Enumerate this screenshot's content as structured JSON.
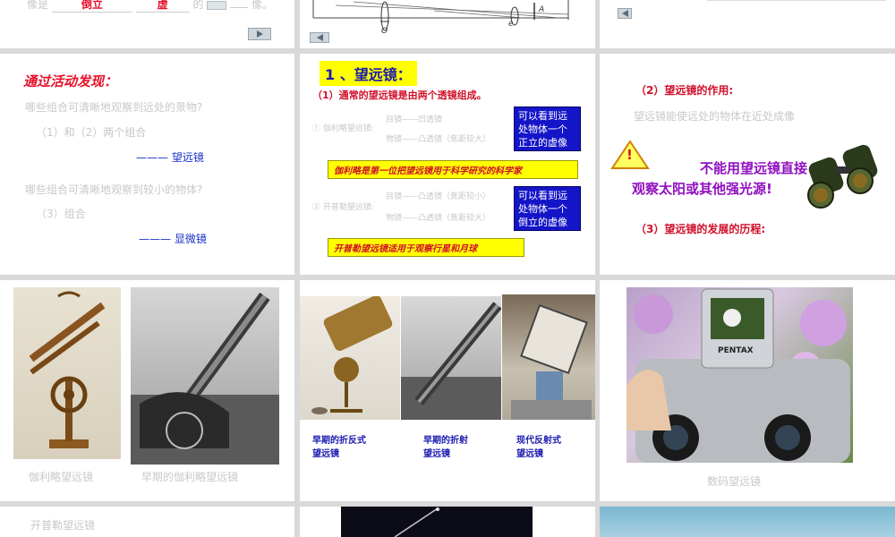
{
  "slide1": {
    "text_prefix": "像是",
    "blank1": "倒立",
    "blank2": "虚",
    "text_mid": "的",
    "text_suffix": "像。"
  },
  "slide2": {
    "label_o": "O",
    "label_e": "e",
    "label_a": "A"
  },
  "slide4": {
    "heading": "通过活动发现：",
    "q1": "哪些组合可清晰地观察到远处的景物?",
    "a1": "（1）和（2）两个组合",
    "r1": "——— 望远镜",
    "q2": "哪些组合可清晰地观察到较小的物体?",
    "a2": "（3）组合",
    "r2": "——— 显微镜"
  },
  "slide5": {
    "title": "1 、望远镜：",
    "subtitle": "（1）通常的望远镜是由两个透镜组成。",
    "g_label": "① 伽利略望远镜:",
    "g_eye": "目镜——凹透镜",
    "g_obj": "物镜——凸透镜（焦距较大）",
    "g_box": [
      "可以看到远",
      "处物体一个",
      "正立的虚像"
    ],
    "g_bar": "伽利略是第一位把望远镜用于科学研究的科学家",
    "k_label": "② 开普勒望远镜:",
    "k_eye": "目镜——凸透镜（焦距较小）",
    "k_obj": "物镜——凸透镜（焦距较大）",
    "k_box": [
      "可以看到远",
      "处物体一个",
      "倒立的虚像"
    ],
    "k_bar": "开普勒望远镜适用于观察行星和月球"
  },
  "slide6": {
    "sub2": "（2）望远镜的作用:",
    "effect": "望远镜能使远处的物体在近处成像",
    "warning_mark": "!",
    "warning_line1": "不能用望远镜直接",
    "warning_line2": "观察太阳或其他强光源!",
    "sub3": "（3）望远镜的发展的历程:"
  },
  "slide7": {
    "cap1": "伽利略望远镜",
    "cap2": "早期的伽利略望远镜"
  },
  "slide8": {
    "cap1": [
      "早期的折反式",
      "望远镜"
    ],
    "cap2": [
      "早期的折射",
      "望远镜"
    ],
    "cap3": [
      "现代反射式",
      "望远镜"
    ]
  },
  "slide9": {
    "brand": "PENTAX",
    "caption": "数码望远镜"
  },
  "slide10": {
    "caption": "开普勒望远镜"
  },
  "icons": {
    "next": "play-right-icon",
    "prev": "play-left-icon",
    "warning": "warning-triangle-icon",
    "binoculars": "binoculars-icon"
  }
}
